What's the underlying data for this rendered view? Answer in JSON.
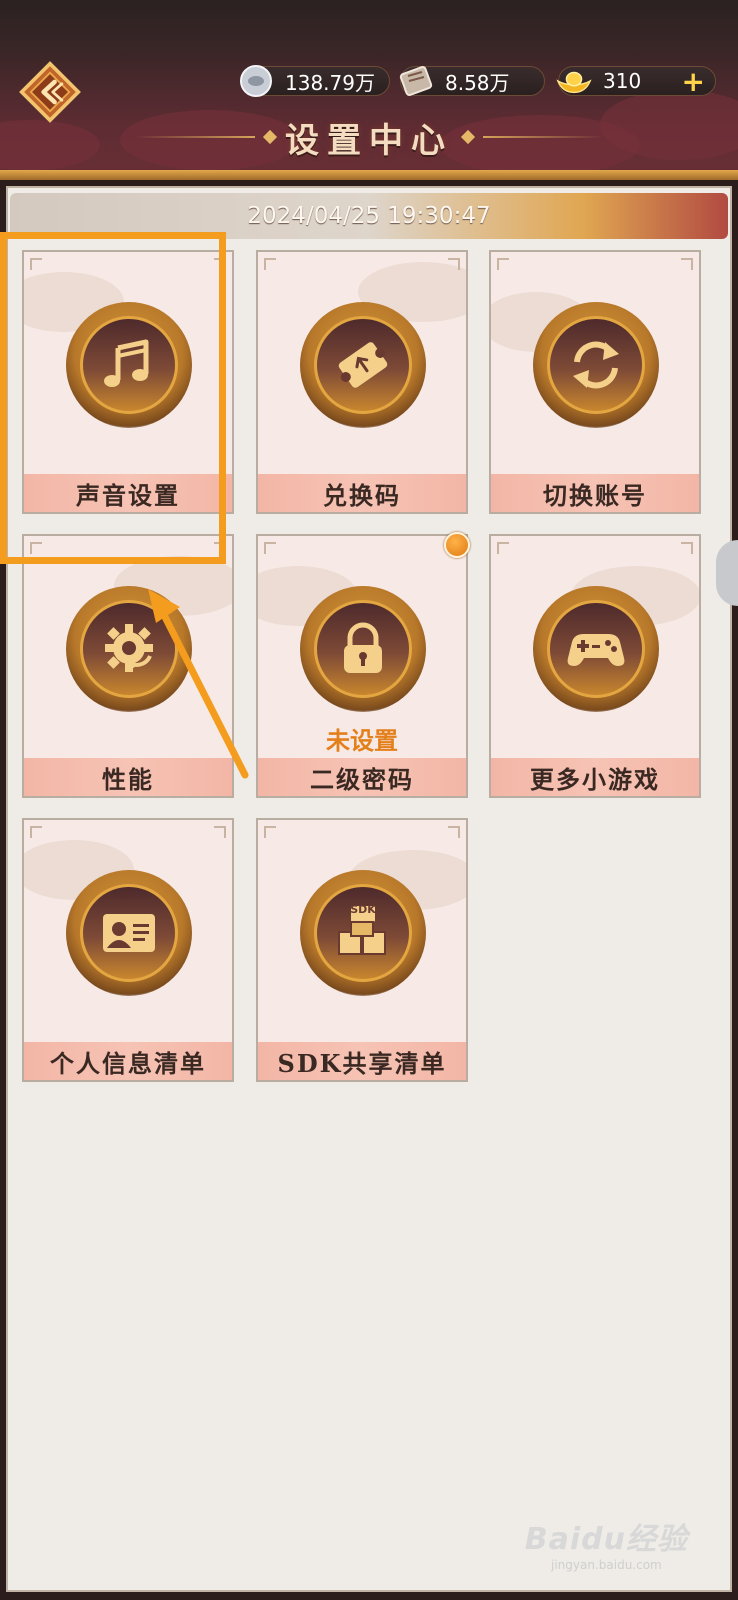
{
  "header": {
    "title": "设置中心",
    "resources": {
      "silver": "138.79万",
      "scroll": "8.58万",
      "gold": "310"
    },
    "add_label": "+"
  },
  "date_bar": {
    "datetime": "2024/04/25 19:30:47"
  },
  "cards": [
    {
      "label": "声音设置",
      "icon": "music-note-icon"
    },
    {
      "label": "兑换码",
      "icon": "ticket-icon"
    },
    {
      "label": "切换账号",
      "icon": "switch-arrows-icon"
    },
    {
      "label": "性能",
      "icon": "gear-icon"
    },
    {
      "label": "二级密码",
      "icon": "lock-icon",
      "status": "未设置"
    },
    {
      "label": "更多小游戏",
      "icon": "gamepad-icon"
    },
    {
      "label": "个人信息清单",
      "icon": "id-card-icon"
    },
    {
      "label": "SDK共享清单",
      "icon": "sdk-boxes-icon",
      "icon_text": "SDK"
    }
  ],
  "watermark": {
    "main": "Baidu经验",
    "sub": "jingyan.baidu.com"
  },
  "colors": {
    "highlight": "#f39c1e",
    "label_bg": "#f3b6a6",
    "status": "#e4801c"
  }
}
